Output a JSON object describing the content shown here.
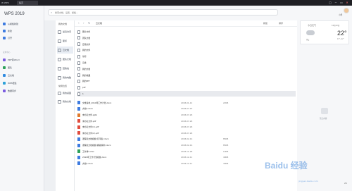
{
  "titlebar": {
    "tab_wps": "W WPS",
    "tab_doc": "稻壳",
    "controls": [
      "▢",
      "─",
      "▭",
      "✕"
    ]
  },
  "sidebar": {
    "logo": "WPS 2019",
    "items": [
      {
        "label": "从模板新建",
        "color": "#3d7be0"
      },
      {
        "label": "新建",
        "color": "#3d7be0"
      },
      {
        "label": "打开",
        "color": "#3d7be0"
      }
    ],
    "section": "应用中心",
    "apps": [
      {
        "label": "PDF转Word",
        "color": "#7b5ce0"
      },
      {
        "label": "团队",
        "color": "#2da15a"
      },
      {
        "label": "云文档",
        "color": "#2f8ae0"
      },
      {
        "label": "WPS便签",
        "color": "#2da1d8"
      },
      {
        "label": "数据同步",
        "color": "#7b5ce0"
      }
    ]
  },
  "topbar": {
    "search_placeholder": "搜索文档、设置、模板…",
    "username": "小熊"
  },
  "folderpane": {
    "title": "我的文档",
    "items": [
      {
        "label": "最近访问",
        "active": false
      },
      {
        "label": "星标",
        "active": false
      },
      {
        "label": "云文档",
        "active": true
      },
      {
        "label": "团队文档",
        "active": false
      },
      {
        "label": "回收站",
        "active": false
      },
      {
        "label": "我的电脑",
        "active": false
      }
    ],
    "section2": "常用位置",
    "items2": [
      "我的桌面",
      "我的文档"
    ]
  },
  "filelist": {
    "crumb": "云文档",
    "tool_new": "新建",
    "tool_sort": "排序",
    "folders": [
      "图片文件",
      "团队文档",
      "应用文件",
      "我的文件",
      "星标",
      "云盘",
      "我的文档",
      "我的收藏",
      "我的PPT",
      "pdf",
      "1"
    ],
    "files": [
      {
        "name": "文章素材_2019年工作计划.docx",
        "type": "doc",
        "date": "2018-01-12",
        "size": "22KB"
      },
      {
        "name": "文档1.docx",
        "type": "doc",
        "date": "2018-07-23",
        "size": ""
      },
      {
        "name": "未命名文件.pptx",
        "type": "ppt",
        "date": "2018-07-26",
        "size": ""
      },
      {
        "name": "未命名文件.pdf",
        "type": "pdf",
        "date": "2018-07-26",
        "size": ""
      },
      {
        "name": "未命名文件(1).pdf",
        "type": "pdf",
        "date": "2018-07-26",
        "size": ""
      },
      {
        "name": "未命名文件(2).pdf",
        "type": "pdf",
        "date": "2018-07-26",
        "size": ""
      },
      {
        "name": "课程表文档模板(打印版).docx",
        "type": "doc",
        "date": "2018-02-14",
        "size": "85KB"
      },
      {
        "name": "课程表文档模板(横版横排).docx",
        "type": "doc",
        "date": "2018-02-14",
        "size": "85KB"
      },
      {
        "name": "工作簿1.xlsx",
        "type": "xls",
        "date": "2018-11-28",
        "size": "10KB"
      },
      {
        "name": "2019年工作计划模板.docx",
        "type": "doc",
        "date": "2018-12-11",
        "size": "40KB"
      },
      {
        "name": "文档1.docx",
        "type": "doc",
        "date": "2018-12-11",
        "size": "40KB"
      }
    ]
  },
  "weather": {
    "title": "今日天气",
    "date": "10月22日",
    "temp": "22°",
    "range": "13°~22°",
    "location": "多云"
  },
  "right": {
    "bag_label": "暂无内容",
    "zoom": "25"
  },
  "watermark": {
    "main": "Baidu 经验",
    "sub": "jingyan.baidu.com"
  }
}
